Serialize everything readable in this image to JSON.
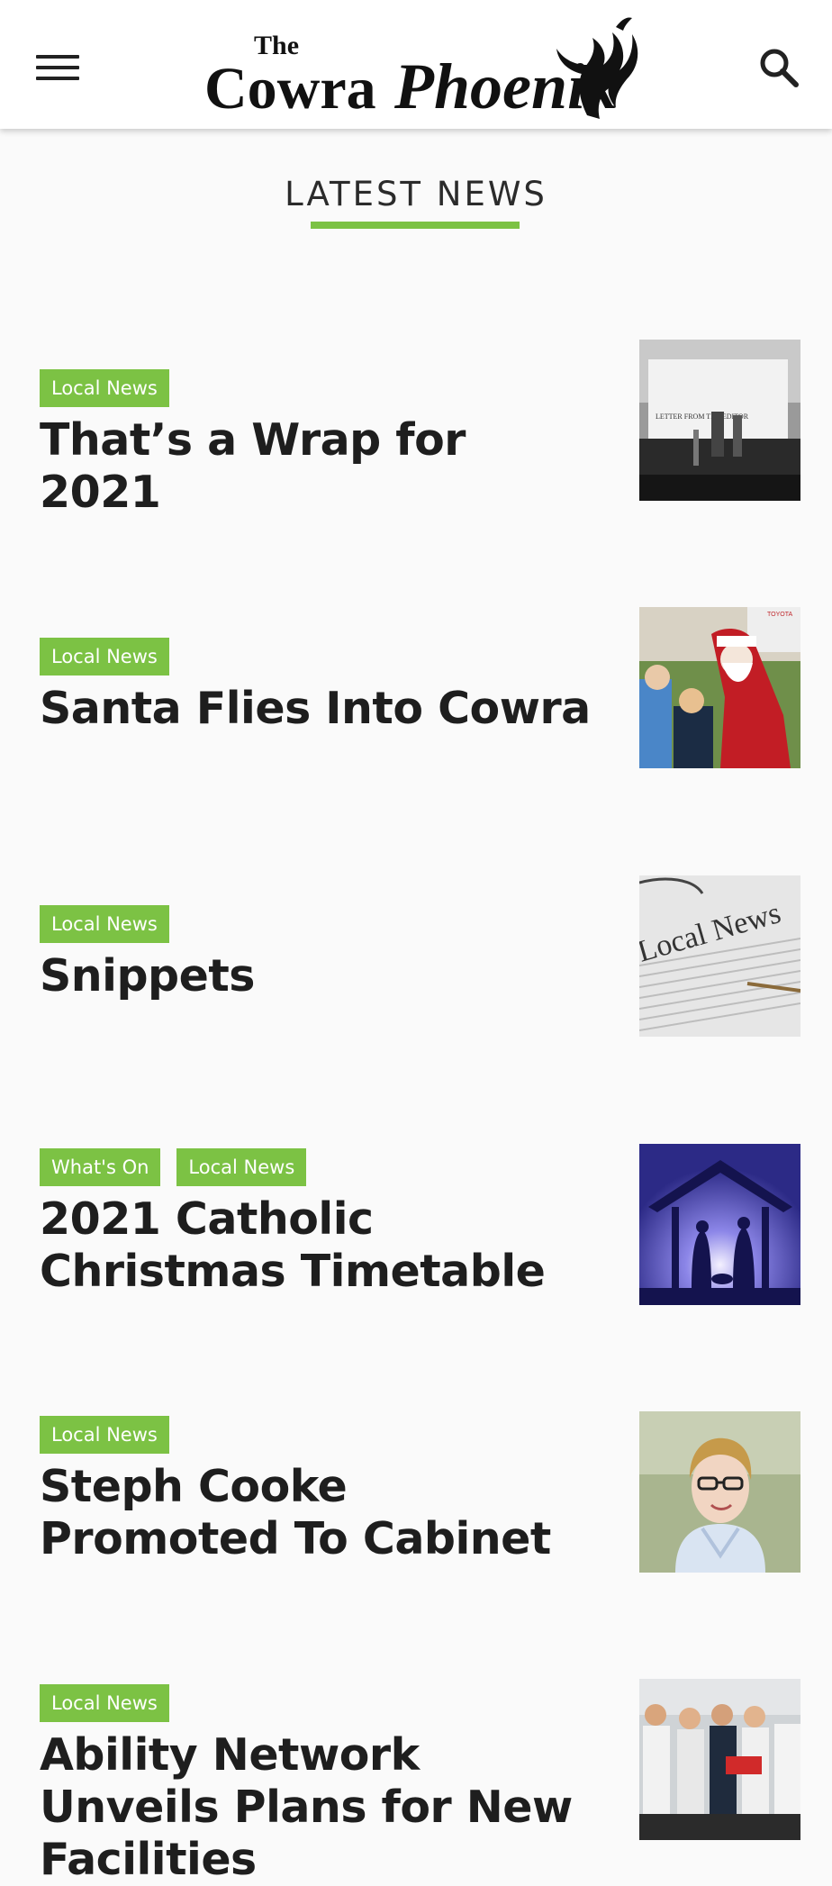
{
  "header": {
    "logo_the": "The",
    "logo_cowra": "Cowra",
    "logo_phoenix": "Phoenix",
    "menu_icon": "hamburger-menu-icon",
    "search_icon": "search-icon"
  },
  "section": {
    "title": "LATEST NEWS",
    "accent_color": "#7cc244"
  },
  "articles": [
    {
      "tags": [
        "Local News"
      ],
      "title": "That’s a Wrap for 2021",
      "thumb": "typewriter-letter-from-the-editor",
      "thumb_text": "LETTER FROM THE EDITOR"
    },
    {
      "tags": [
        "Local News"
      ],
      "title": "Santa Flies Into Cowra",
      "thumb": "santa-with-children",
      "thumb_text": "TOYOTA"
    },
    {
      "tags": [
        "Local News"
      ],
      "title": "Snippets",
      "thumb": "local-news-newspaper",
      "thumb_text": "Local News"
    },
    {
      "tags": [
        "What's On",
        "Local News"
      ],
      "title": "2021 Catholic Christmas Timetable",
      "thumb": "nativity-scene"
    },
    {
      "tags": [
        "Local News"
      ],
      "title": "Steph Cooke Promoted To Cabinet",
      "thumb": "woman-portrait"
    },
    {
      "tags": [
        "Local News"
      ],
      "title": "Ability Network Unveils Plans for New Facilities",
      "thumb": "group-photo"
    }
  ]
}
